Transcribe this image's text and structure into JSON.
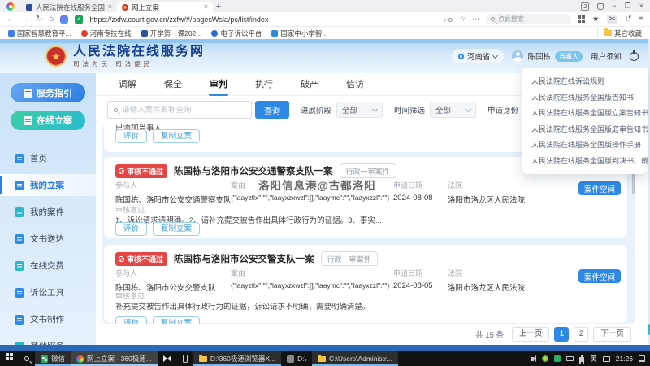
{
  "browser": {
    "tab1": "人民法院在线服务全国版_百...",
    "tab2": "网上立案",
    "tab_count_badge": "2",
    "url": "https://zxfw.court.gov.cn/zxfw/#/pagesWsla/pc/list/index",
    "search_placeholder": "点此搜索",
    "bookmarks": [
      "国家智慧教育平...",
      "河南专技在线",
      "开学第一课202...",
      "电子诉讼平台",
      "国家中小学智..."
    ],
    "other_favorites": "其它收藏"
  },
  "header": {
    "site_title": "人民法院在线服务网",
    "slogan": "司法为民  司法便民",
    "region": "河南省",
    "username": "陈国栋",
    "user_badge": "当事人",
    "notice": "用户须知"
  },
  "dropdown": {
    "items": [
      "人民法院在线诉讼规则",
      "人民法院在线服务全国版告知书",
      "人民法院在线服务全国版立案告知书",
      "人民法院在线服务全国版庭审告知书",
      "人民法院在线服务全国版操作手册",
      "人民法院在线服务全国版判决书、裁..."
    ]
  },
  "sidebar": {
    "btn_service_guide": "服务指引",
    "btn_online_filing": "在线立案",
    "items": [
      "首页",
      "我的立案",
      "我的案件",
      "文书送达",
      "在线交费",
      "诉讼工具",
      "文书制作",
      "其他服务"
    ]
  },
  "tabs": [
    "调解",
    "保全",
    "审判",
    "执行",
    "破产",
    "信访"
  ],
  "filters": {
    "search_placeholder": "请输入案件名称查询",
    "search_button": "查询",
    "stage_label": "进展阶段",
    "stage_value": "全部",
    "time_label": "时间筛选",
    "time_value": "全部",
    "identity_label": "申请身份",
    "identity_value": "全部"
  },
  "list": {
    "partial_text": "已添加当事人",
    "btn_evaluate": "评价",
    "btn_copy": "复制立案",
    "btn_space": "案件空间",
    "watermark": "洛阳信息港@古都洛阳",
    "cases": [
      {
        "status": "审核不通过",
        "title": "陈国栋与洛阳市公安交通警察支队一案",
        "tag": "行政一审案件",
        "f1_label": "参与人",
        "f1_value": "陈国栋、洛阳市公安交通警察支队",
        "f2_label": "案由",
        "f2_value": "{\"laayztlx\":\"\",\"laayxzxwzl\":[],\"laaymc\":\"\",\"laayxzzl\":\"\"}",
        "f3_label": "申请日期",
        "f3_value": "2024-08-08",
        "f4_label": "法院",
        "f4_value": "洛阳市洛龙区人民法院",
        "review_label": "审核意见",
        "review": "1、诉讼请求请明确。2、请补充提交被告作出具体行政行为的证据。3、事实..."
      },
      {
        "status": "审核不通过",
        "title": "陈国栋与洛阳市公安交警支队一案",
        "tag": "行政一审案件",
        "f1_label": "参与人",
        "f1_value": "陈国栋、洛阳市公安交警支队",
        "f2_label": "案由",
        "f2_value": "{\"laayztlx\":\"\",\"laayxzxwzl\":[],\"laaymc\":\"\",\"laayxzzl\":\"\"}",
        "f3_label": "申请日期",
        "f3_value": "2024-08-05",
        "f4_label": "法院",
        "f4_value": "洛阳市洛龙区人民法院",
        "review_label": "审核意见",
        "review": "补充提交被告作出具体行政行为的证据，诉讼请求不明确，需要明确清楚。"
      }
    ]
  },
  "pagination": {
    "total": "共 15 条",
    "prev": "上一页",
    "page1": "1",
    "page2": "2",
    "next": "下一页"
  },
  "taskbar": {
    "wechat": "微信",
    "browser": "网上立案 - 360极速...",
    "folder1": "D:\\360极速浏览器X...",
    "folder2": "D:\\",
    "folder3": "C:\\Users\\Administr...",
    "lang": "英",
    "time": "21:26"
  },
  "colors": {
    "accent_blue": "#2e89e5",
    "teal_accent": "#2bb8c9",
    "status_red": "#e64545",
    "party_badge_blue": "#7cc5ea",
    "footer_blue": "#2a69b5"
  },
  "emblem_star": "★"
}
